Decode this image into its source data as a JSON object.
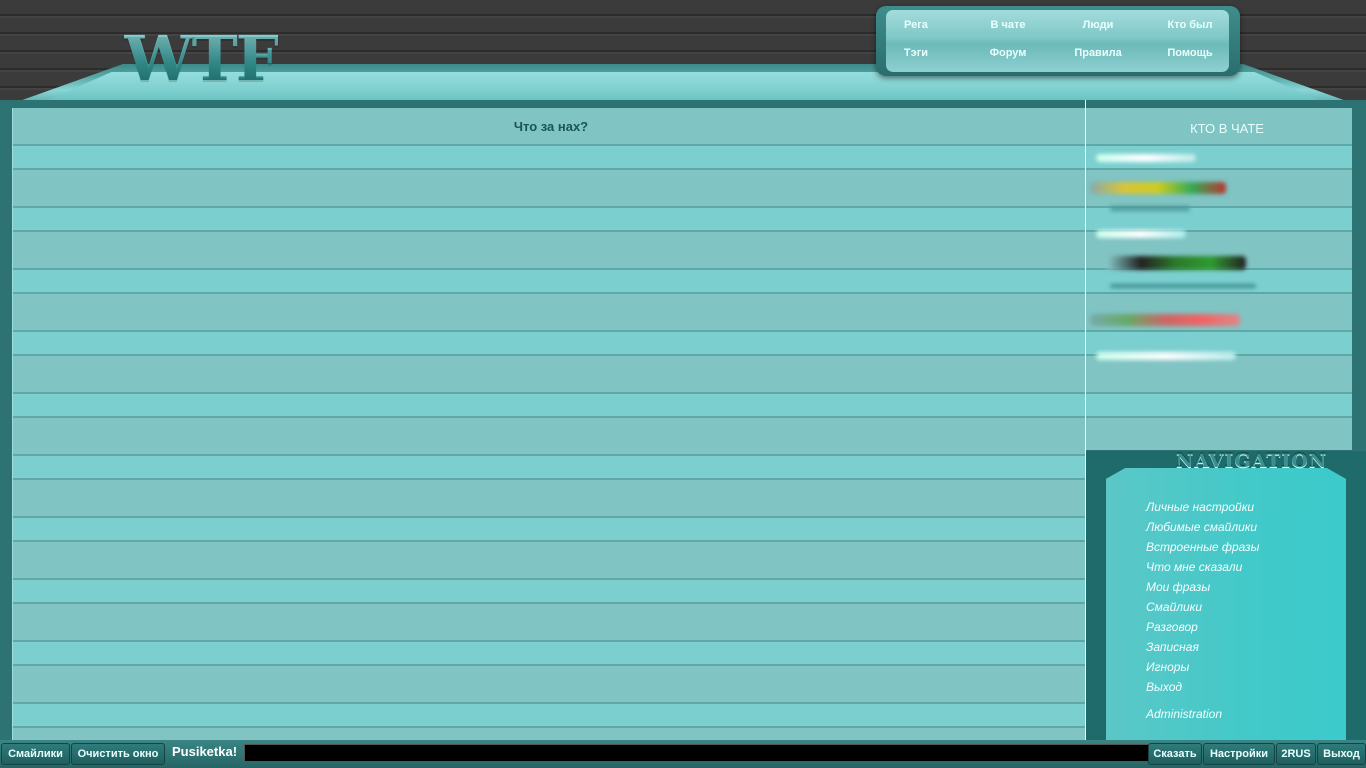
{
  "header": {
    "logo": "WTF",
    "topnav": [
      {
        "label": "Рега"
      },
      {
        "label": "В чате"
      },
      {
        "label": "Люди"
      },
      {
        "label": "Кто был"
      },
      {
        "label": "Тэги"
      },
      {
        "label": "Форум"
      },
      {
        "label": "Правила"
      },
      {
        "label": "Помощь"
      }
    ]
  },
  "chat": {
    "title": "Что за нах?"
  },
  "users": {
    "title": "КТО В ЧАТЕ"
  },
  "navigation": {
    "title": "NAVIGATION",
    "items": [
      {
        "label": "Личные настройки"
      },
      {
        "label": "Любимые смайлики"
      },
      {
        "label": "Встроенные фразы"
      },
      {
        "label": "Что мне сказали"
      },
      {
        "label": "Мои фразы"
      },
      {
        "label": "Смайлики"
      },
      {
        "label": "Разговор"
      },
      {
        "label": "Записная"
      },
      {
        "label": "Игноры"
      },
      {
        "label": "Выход"
      },
      {
        "label": "Administration"
      }
    ]
  },
  "bottombar": {
    "smileys_button": "Смайлики",
    "clear_button": "Очистить окно",
    "nick": "Pusiketka!",
    "message_value": "",
    "send_button": "Сказать",
    "settings_button": "Настройки",
    "translit_button": "2RUS",
    "exit_button": "Выход"
  }
}
